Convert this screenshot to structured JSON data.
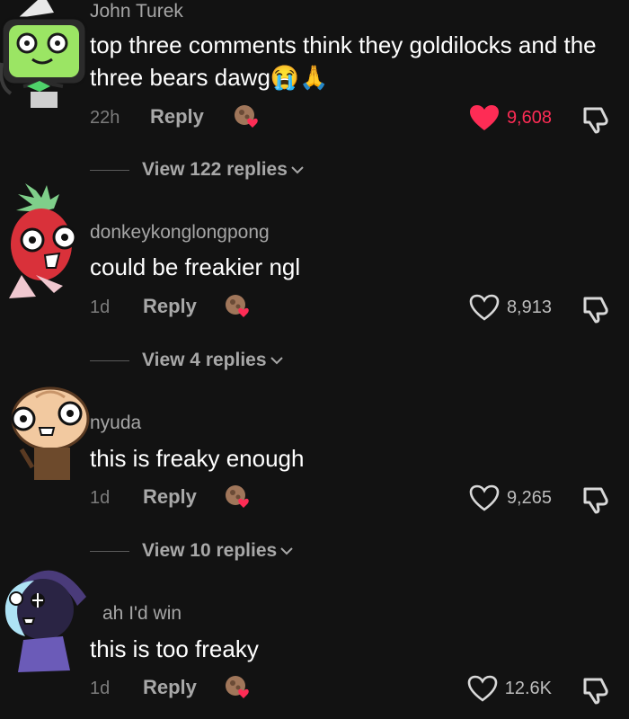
{
  "comments": [
    {
      "username": "John Turek",
      "text": "top three comments think they goldilocks and the three bears dawg",
      "emoji": "😭🙏",
      "time": "22h",
      "reply_label": "Reply",
      "likes": "9,608",
      "liked": true,
      "view_replies": "View 122 replies",
      "avatar_icon": "tv-robot-avatar"
    },
    {
      "username": "donkeykonglongpong",
      "text": "could be freakier ngl",
      "time": "1d",
      "reply_label": "Reply",
      "likes": "8,913",
      "liked": false,
      "view_replies": "View 4 replies",
      "avatar_icon": "strawberry-avatar"
    },
    {
      "username": "nyuda",
      "text": "this is freaky enough",
      "time": "1d",
      "reply_label": "Reply",
      "likes": "9,265",
      "liked": false,
      "view_replies": "View 10 replies",
      "avatar_icon": "cookie-avatar"
    },
    {
      "username": "ah I'd win",
      "text": "this is too freaky",
      "time": "1d",
      "reply_label": "Reply",
      "likes": "12.6K",
      "liked": false,
      "avatar_icon": "moon-avatar"
    }
  ],
  "colors": {
    "background": "#121212",
    "like_active": "#fe2c55",
    "muted": "#a8a8a8"
  }
}
